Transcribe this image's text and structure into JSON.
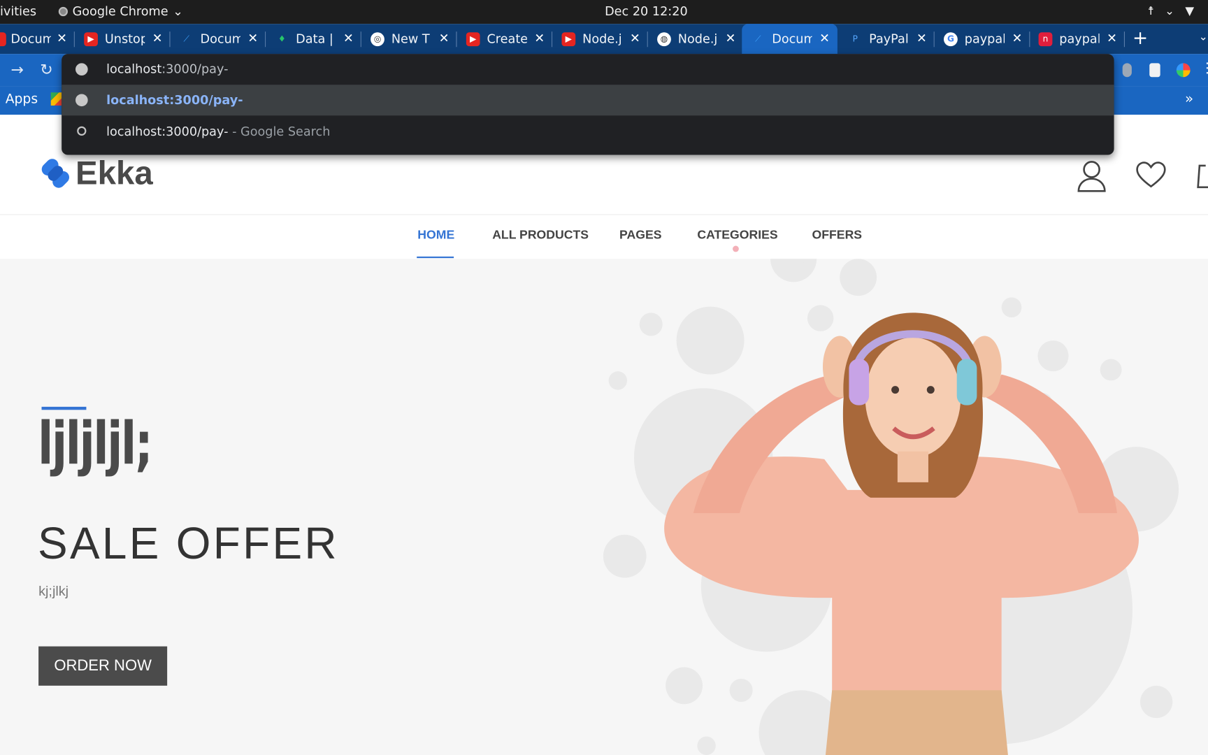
{
  "os_bar": {
    "activities": "ivities",
    "app_name": "Google Chrome",
    "clock": "Dec 20  12:20"
  },
  "tabs": [
    {
      "title": "Docum",
      "icon": "docs-icon"
    },
    {
      "title": "Unstop",
      "icon": "youtube-icon"
    },
    {
      "title": "Docum",
      "icon": "docs-icon"
    },
    {
      "title": "Data |",
      "icon": "mongodb-icon"
    },
    {
      "title": "New T",
      "icon": "chrome-icon"
    },
    {
      "title": "Create",
      "icon": "youtube-icon"
    },
    {
      "title": "Node.j",
      "icon": "youtube-icon"
    },
    {
      "title": "Node.j",
      "icon": "globe-icon"
    },
    {
      "title": "Docum",
      "icon": "docs-icon",
      "active": true
    },
    {
      "title": "PayPal",
      "icon": "paypal-icon"
    },
    {
      "title": "paypal",
      "icon": "google-icon"
    },
    {
      "title": "paypal",
      "icon": "npm-icon"
    }
  ],
  "new_tab": "+",
  "bookmarks": {
    "apps_label": "Apps",
    "overflow": "»"
  },
  "omnibox": {
    "input_host": "localhost",
    "input_path": ":3000/pay-",
    "suggestion_url": "localhost:3000/pay-",
    "search_query": "localhost:3000/pay-",
    "search_suffix": " - Google Search"
  },
  "site": {
    "brand": "Ekka",
    "nav": [
      "HOME",
      "ALL PRODUCTS",
      "PAGES",
      "CATEGORIES",
      "OFFERS"
    ],
    "active_nav": "HOME"
  },
  "hero": {
    "title": "ljljljl;",
    "headline": "SALE OFFER",
    "subtitle": "kj;jlkj",
    "cta": "ORDER NOW"
  },
  "colors": {
    "accent": "#3474d4",
    "tabstrip": "#0d3d75",
    "toolbar": "#1a66c1",
    "button": "#4b4b4b"
  }
}
